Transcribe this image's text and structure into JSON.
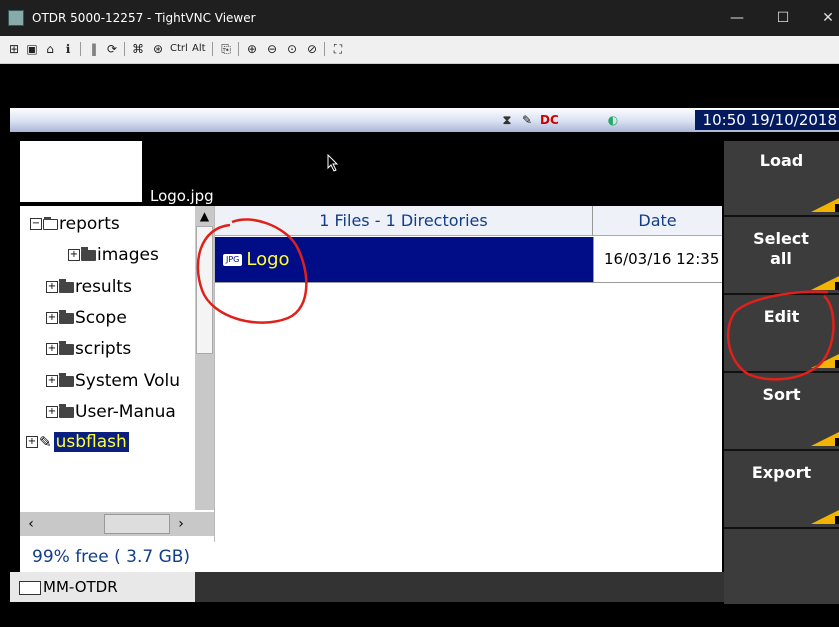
{
  "window": {
    "title": "OTDR 5000-12257 - TightVNC Viewer",
    "controls": {
      "minimize": "—",
      "maximize": "☐",
      "close": "✕"
    }
  },
  "toolbar": {
    "ctrl_label": "Ctrl",
    "alt_label": "Alt"
  },
  "status": {
    "clock": "10:50 19/10/2018"
  },
  "preview": {
    "filename": "Logo.jpg"
  },
  "tree": {
    "items": [
      {
        "label": "reports",
        "expander": "⊟"
      },
      {
        "label": "images",
        "expander": "⊞"
      },
      {
        "label": "results",
        "expander": "⊞"
      },
      {
        "label": "Scope",
        "expander": "⊞"
      },
      {
        "label": "scripts",
        "expander": "⊞"
      },
      {
        "label": "System Volu",
        "expander": "⊞"
      },
      {
        "label": "User-Manua",
        "expander": "⊞"
      },
      {
        "label": "usbflash",
        "expander": "⊞"
      }
    ]
  },
  "storage": {
    "free_text": "99% free ( 3.7 GB)"
  },
  "module": {
    "label": "MM-OTDR"
  },
  "files": {
    "header_name": "1 Files - 1 Directories",
    "header_date": "Date",
    "rows": [
      {
        "badge": "JPG",
        "name": "Logo",
        "date": "16/03/16 12:35"
      }
    ]
  },
  "sidebar": {
    "buttons": [
      {
        "label": "Load"
      },
      {
        "label": "Select all"
      },
      {
        "label": "Edit"
      },
      {
        "label": "Sort"
      },
      {
        "label": "Export"
      }
    ]
  },
  "colors": {
    "selection_bg": "#000d87",
    "selection_text": "#ffff33",
    "annotation": "#e0201a",
    "softkey_accent": "#f2b400"
  }
}
